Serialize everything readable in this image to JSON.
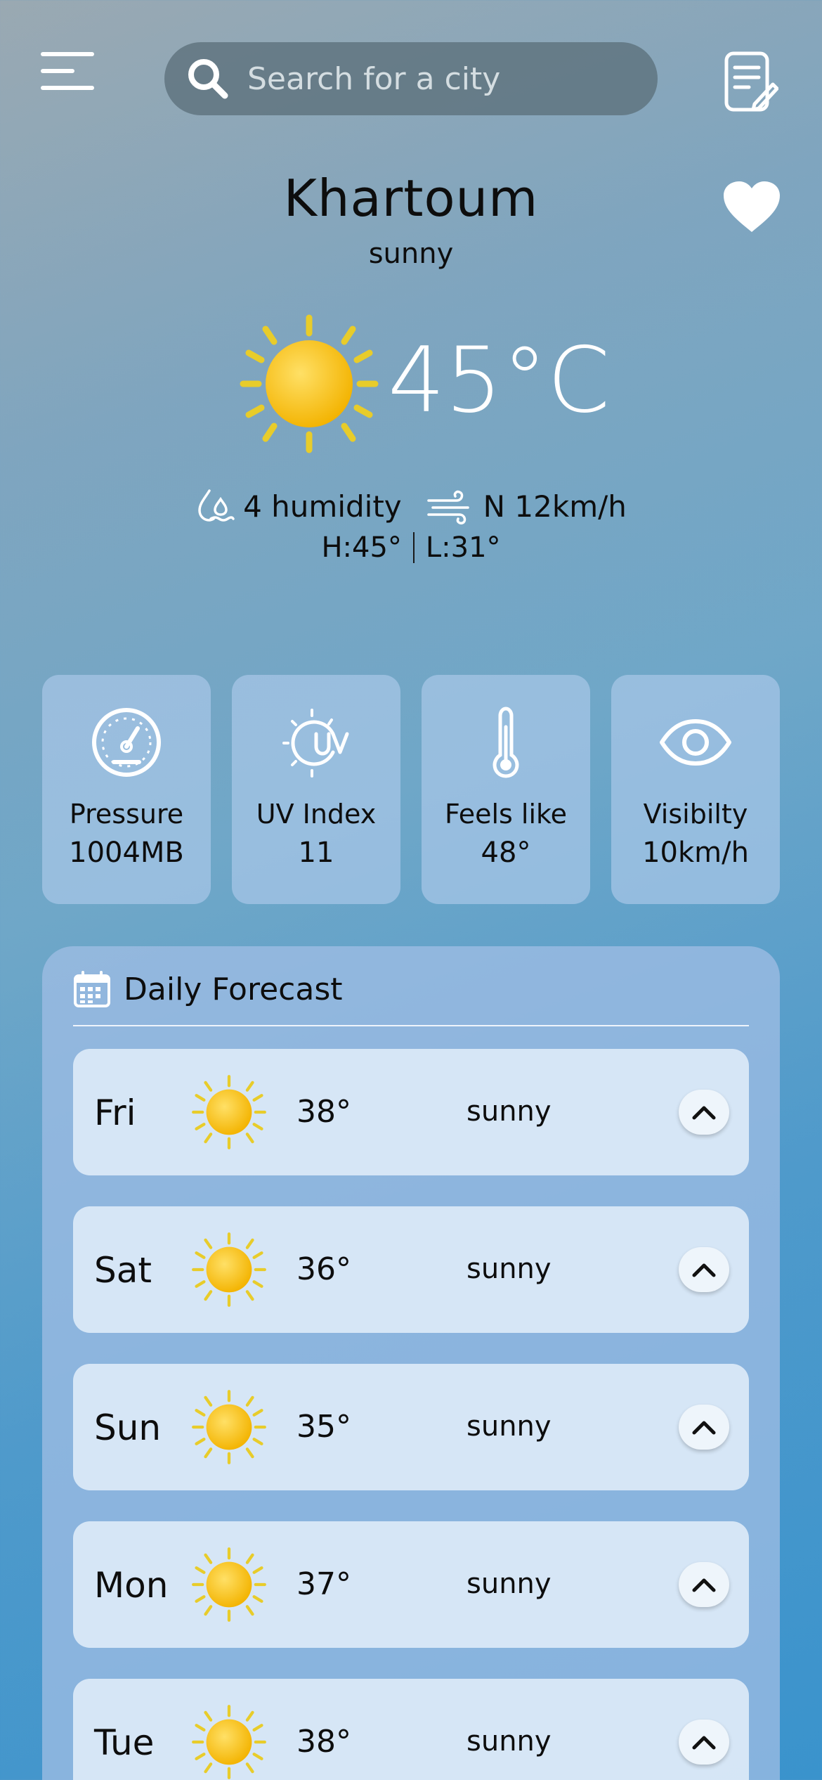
{
  "search": {
    "placeholder": "Search for a city"
  },
  "location": {
    "city": "Khartoum",
    "condition": "sunny"
  },
  "current": {
    "temperature": "45°C",
    "humidity": "4 humidity",
    "wind": "N 12km/h",
    "high": "H:45°",
    "low": "L:31°"
  },
  "cards": [
    {
      "label": "Pressure",
      "value": "1004MB",
      "icon": "gauge-icon"
    },
    {
      "label": "UV Index",
      "value": "11",
      "icon": "uv-icon"
    },
    {
      "label": "Feels like",
      "value": "48°",
      "icon": "thermometer-icon"
    },
    {
      "label": "Visibilty",
      "value": "10km/h",
      "icon": "eye-icon"
    }
  ],
  "forecast": {
    "title": "Daily Forecast",
    "days": [
      {
        "day": "Fri",
        "temp": "38°",
        "condition": "sunny"
      },
      {
        "day": "Sat",
        "temp": "36°",
        "condition": "sunny"
      },
      {
        "day": "Sun",
        "temp": "35°",
        "condition": "sunny"
      },
      {
        "day": "Mon",
        "temp": "37°",
        "condition": "sunny"
      },
      {
        "day": "Tue",
        "temp": "38°",
        "condition": "sunny"
      }
    ]
  },
  "colors": {
    "sun": "#f7c200",
    "ray": "#e8cc2a",
    "card": "#aac8e8",
    "panel": "#a0bee4",
    "row": "#dceaf7"
  }
}
